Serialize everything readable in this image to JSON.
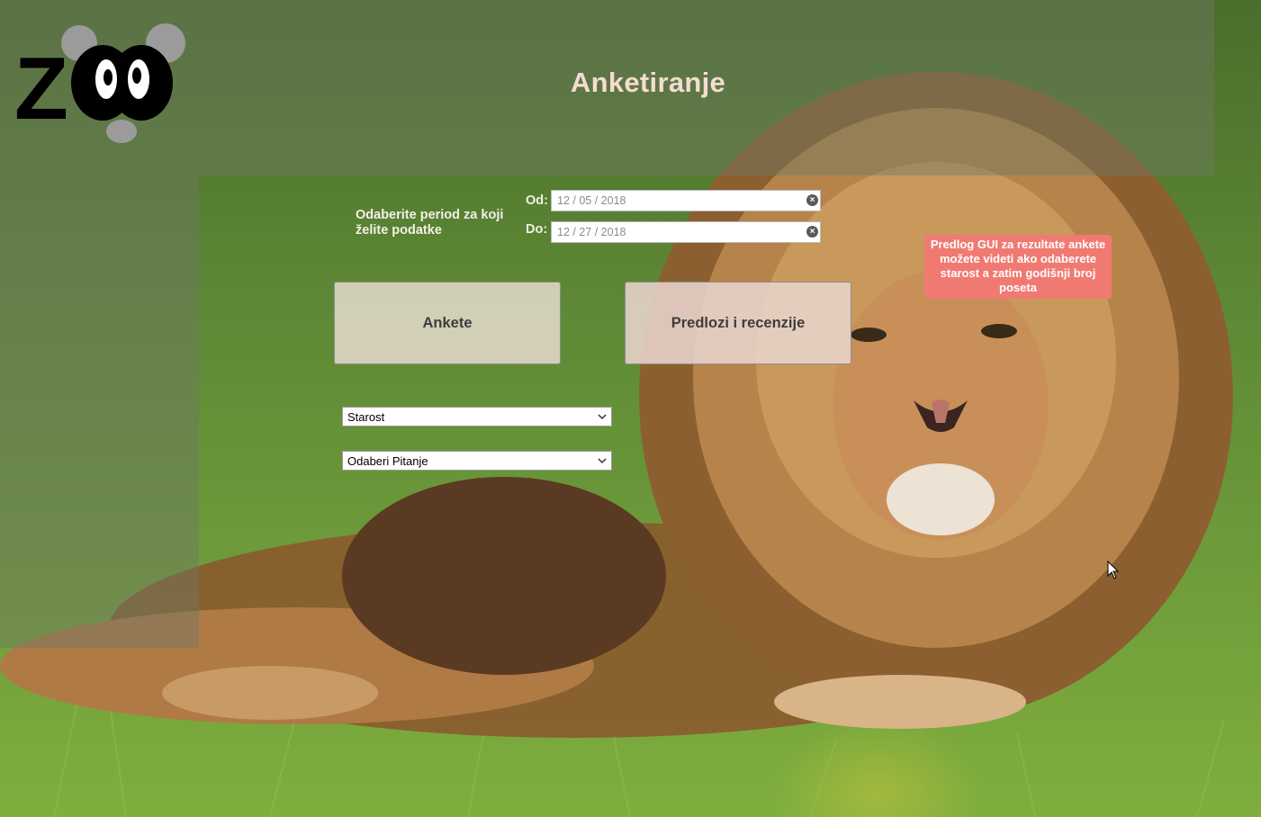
{
  "header": {
    "title": "Anketiranje"
  },
  "logo": {
    "text": "Z",
    "icon": "panda-eyes-icon"
  },
  "period": {
    "label": "Odaberite period za koji želite podatke",
    "from_label": "Od:",
    "from_value": "12 / 05 / 2018",
    "to_label": "Do:",
    "to_value": "12 / 27 / 2018"
  },
  "buttons": {
    "ankete": "Ankete",
    "predlozi": "Predlozi i recenzije"
  },
  "note": "Predlog GUI za rezultate ankete možete videti ako odaberete starost a zatim godišnji broj poseta",
  "selects": {
    "age": "Starost",
    "question": "Odaberi Pitanje"
  },
  "colors": {
    "title": "#f3dcd0",
    "note_bg": "#f07a72",
    "overlay": "#6e7864"
  }
}
